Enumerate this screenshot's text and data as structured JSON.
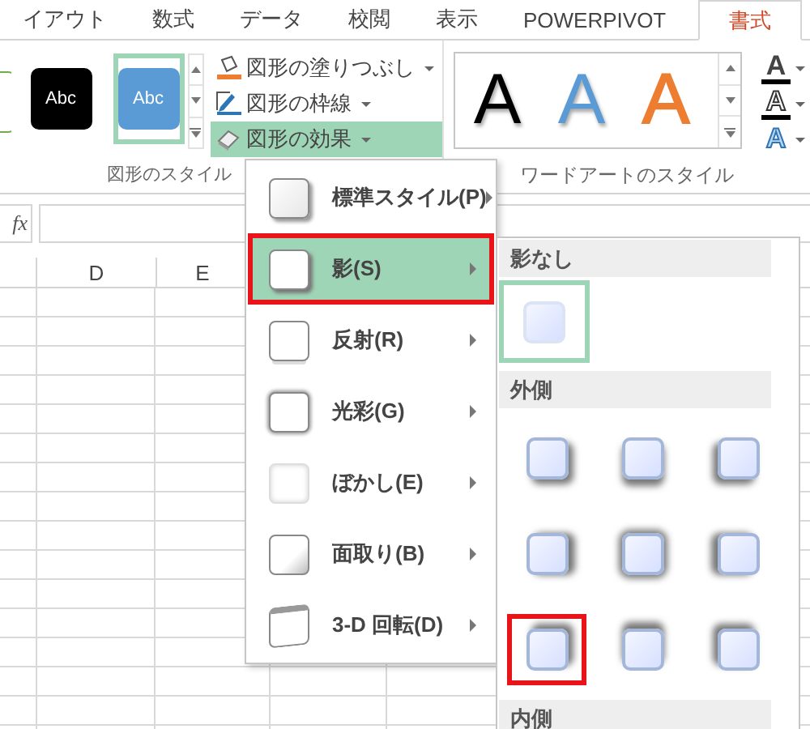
{
  "ribbon_tabs": [
    {
      "label": "イアウト",
      "selected": false
    },
    {
      "label": "数式",
      "selected": false
    },
    {
      "label": "データ",
      "selected": false
    },
    {
      "label": "校閲",
      "selected": false
    },
    {
      "label": "表示",
      "selected": false
    },
    {
      "label": "POWERPIVOT",
      "selected": false
    },
    {
      "label": "書式",
      "selected": true
    }
  ],
  "ribbon": {
    "shape_styles": {
      "gallery": [
        {
          "kind": "outline",
          "color": "#70ad47",
          "selected": false
        },
        {
          "kind": "filled",
          "color": "#000000",
          "label": "Abc",
          "selected": false
        },
        {
          "kind": "filled",
          "color": "#5b9bd5",
          "label": "Abc",
          "selected": true
        }
      ],
      "commands": [
        {
          "kind": "fill",
          "label": "図形の塗りつぶし",
          "open": false
        },
        {
          "kind": "outline",
          "label": "図形の枠線",
          "open": false
        },
        {
          "kind": "effects",
          "label": "図形の効果",
          "open": true
        }
      ],
      "group_label": "図形のスタイル"
    },
    "wordart_styles": {
      "gallery": [
        {
          "kind": "filled",
          "label": "A",
          "color": "#000000"
        },
        {
          "kind": "filled",
          "label": "A",
          "color": "#5b9bd5"
        },
        {
          "kind": "outline",
          "label": "A",
          "color": "#ed7d31"
        }
      ],
      "text_tools": [
        {
          "kind": "fill",
          "label": "A"
        },
        {
          "kind": "outline",
          "label": "A"
        },
        {
          "kind": "effects",
          "label": "A"
        }
      ],
      "group_label": "ワードアートのスタイル"
    }
  },
  "formula_bar": {
    "function_label": "fx"
  },
  "sheet": {
    "columns": [
      "D",
      "E"
    ]
  },
  "effects_menu": [
    {
      "kind": "standard",
      "label": "標準スタイル(P)",
      "selected": false
    },
    {
      "kind": "shadow",
      "label": "影(S)",
      "selected": true
    },
    {
      "kind": "reflection",
      "label": "反射(R)",
      "selected": false
    },
    {
      "kind": "glow",
      "label": "光彩(G)",
      "selected": false
    },
    {
      "kind": "soft-edges",
      "label": "ぼかし(E)",
      "selected": false
    },
    {
      "kind": "bevel",
      "label": "面取り(B)",
      "selected": false
    },
    {
      "kind": "rotation",
      "label": "3-D 回転(D)",
      "selected": false
    }
  ],
  "shadow_menu": {
    "no_shadow": {
      "title": "影なし",
      "selected": true
    },
    "outer": {
      "title": "外側",
      "presets": [
        {
          "kind": "bottom-right",
          "selected": false
        },
        {
          "kind": "bottom",
          "selected": false
        },
        {
          "kind": "bottom-left",
          "selected": false
        },
        {
          "kind": "right",
          "selected": false
        },
        {
          "kind": "center",
          "selected": false
        },
        {
          "kind": "left",
          "selected": false
        },
        {
          "kind": "top-right",
          "selected": true
        },
        {
          "kind": "top",
          "selected": false
        },
        {
          "kind": "top-left",
          "selected": false
        }
      ]
    },
    "inner": {
      "title": "内側"
    }
  }
}
